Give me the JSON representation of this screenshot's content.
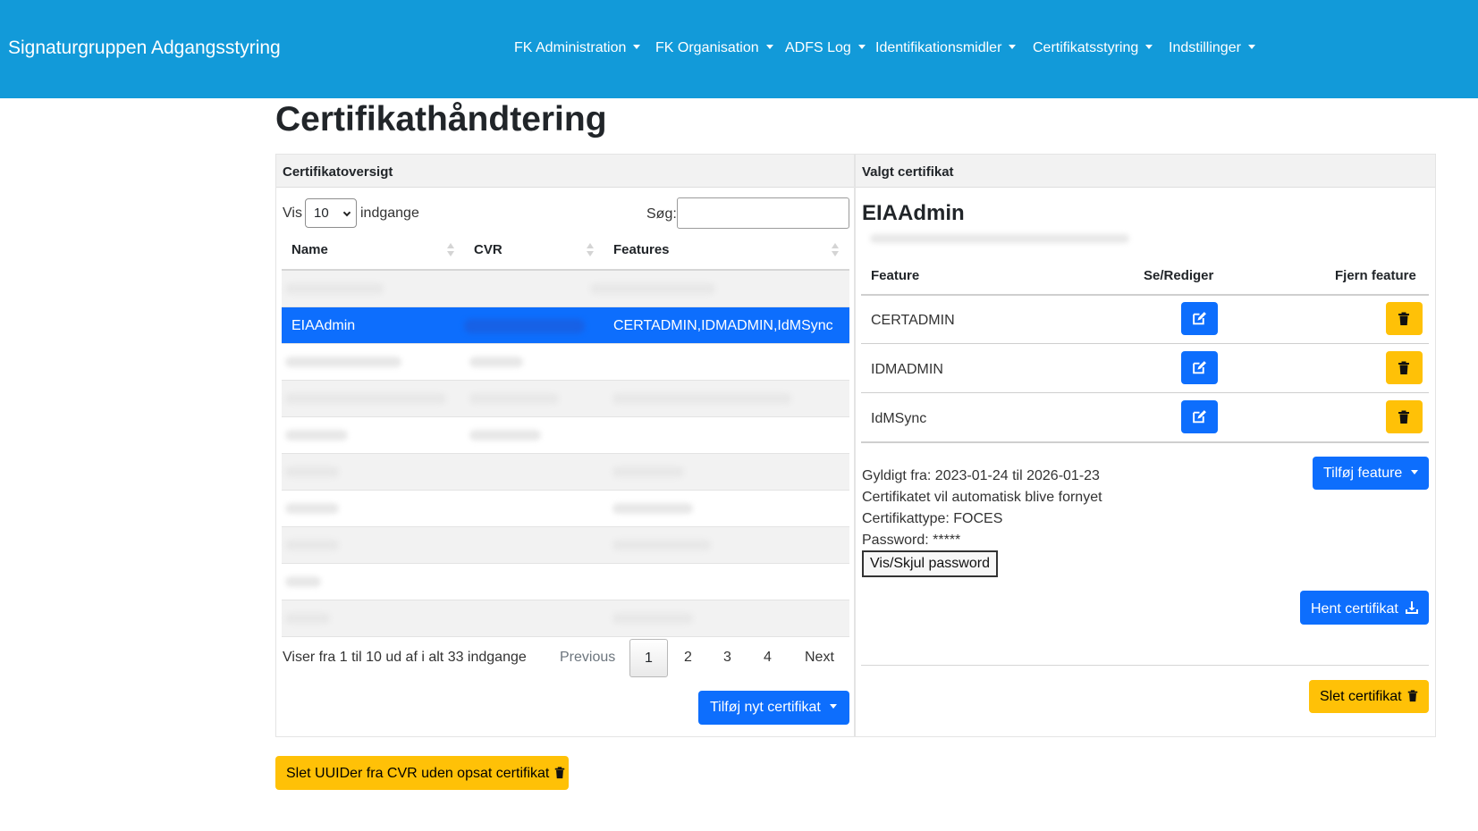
{
  "navbar": {
    "brand": "Signaturgruppen Adgangsstyring",
    "items": [
      {
        "label": "FK Administration"
      },
      {
        "label": "FK Organisation"
      },
      {
        "label": "ADFS Log"
      },
      {
        "label": "Identifikationsmidler"
      },
      {
        "label": "Certifikatsstyring"
      },
      {
        "label": "Indstillinger"
      }
    ],
    "background_color": "#129ad9"
  },
  "page_title": "Certifikathåndtering",
  "overview": {
    "header": "Certifikatoversigt",
    "length_label_prefix": "Vis",
    "length_value": "10",
    "length_label_suffix": "indgange",
    "search_label": "Søg:",
    "search_value": "",
    "columns": [
      "Name",
      "CVR",
      "Features"
    ],
    "selected_row": {
      "name": "EIAAdmin",
      "features": "CERTADMIN,IDMADMIN,IdMSync"
    },
    "info": "Viser fra 1 til 10 ud af i alt 33 indgange",
    "pagination": {
      "previous": "Previous",
      "pages": [
        "1",
        "2",
        "3",
        "4"
      ],
      "current": "1",
      "next": "Next"
    },
    "add_button": "Tilføj nyt certifikat",
    "accent_color": "#0d6efd"
  },
  "selected": {
    "header": "Valgt certifikat",
    "name": "EIAAdmin",
    "columns": [
      "Feature",
      "Se/Rediger",
      "Fjern feature"
    ],
    "features": [
      "CERTADMIN",
      "IDMADMIN",
      "IdMSync"
    ],
    "add_feature_button": "Tilføj feature",
    "valid": "Gyldigt fra: 2023-01-24 til 2026-01-23",
    "renew": "Certifikatet vil automatisk blive fornyet",
    "type": "Certifikattype: FOCES",
    "password": "Password: *****",
    "toggle_password_button": "Vis/Skjul password",
    "download_button": "Hent certifikat",
    "delete_button": "Slet certifikat",
    "warning_color": "#ffc107"
  },
  "bottom_button": "Slet UUIDer fra CVR uden opsat certifikat"
}
